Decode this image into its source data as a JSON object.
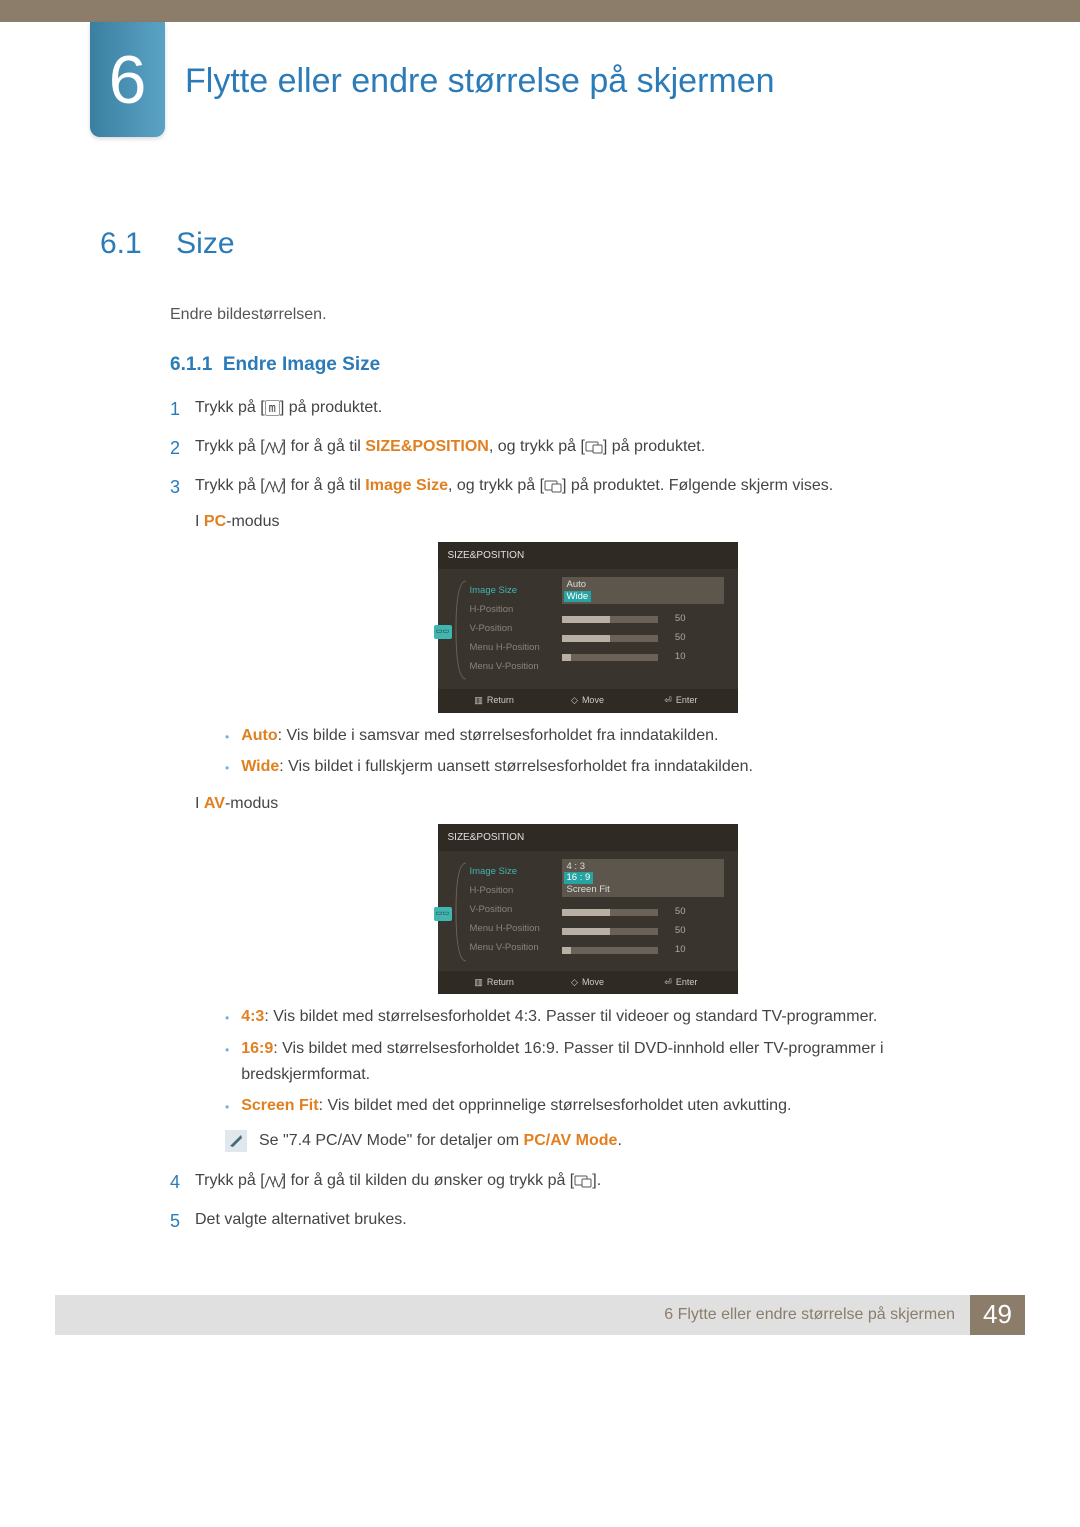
{
  "chapter": {
    "num": "6",
    "title": "Flytte eller endre størrelse på skjermen"
  },
  "section": {
    "num": "6.1",
    "title": "Size",
    "intro": "Endre bildestørrelsen."
  },
  "subsection": {
    "num": "6.1.1",
    "title": "Endre Image Size"
  },
  "steps": {
    "s1": {
      "pre": "Trykk på [",
      "post": "] på produktet.",
      "btn": "m"
    },
    "s2": {
      "a": "Trykk på [",
      "b": "] for å gå til ",
      "hl": "SIZE&POSITION",
      "c": ", og trykk på [",
      "d": "] på produktet."
    },
    "s3": {
      "a": "Trykk på [",
      "b": "] for å gå til ",
      "hl": "Image Size",
      "c": ", og trykk på [",
      "d": "] på produktet. Følgende skjerm vises."
    },
    "pcmode": {
      "pre": "I ",
      "hl": "PC",
      "post": "-modus"
    },
    "avmode": {
      "pre": "I ",
      "hl": "AV",
      "post": "-modus"
    },
    "s4": {
      "a": "Trykk på [",
      "b": "] for å gå til kilden du ønsker og trykk på [",
      "c": "]."
    },
    "s5": "Det valgte alternativet brukes."
  },
  "osd": {
    "title": "SIZE&POSITION",
    "row_imgsize": "Image Size",
    "row_hpos": "H-Position",
    "row_vpos": "V-Position",
    "row_mhpos": "Menu H-Position",
    "row_mvpos": "Menu V-Position",
    "val50": "50",
    "val10": "10",
    "pc": {
      "opt1": "Auto",
      "opt2": "Wide"
    },
    "av": {
      "opt1": "4 : 3",
      "opt2": "16 : 9",
      "opt3": "Screen Fit"
    },
    "foot": {
      "return": "Return",
      "move": "Move",
      "enter": "Enter"
    }
  },
  "bullets_pc": {
    "auto": {
      "hl": "Auto",
      "txt": ": Vis bilde i samsvar med størrelsesforholdet fra inndatakilden."
    },
    "wide": {
      "hl": "Wide",
      "txt": ": Vis bildet i fullskjerm uansett størrelsesforholdet fra inndatakilden."
    }
  },
  "bullets_av": {
    "r43": {
      "hl": "4:3",
      "txt": ": Vis bildet med størrelsesforholdet 4:3. Passer til videoer og standard TV-programmer."
    },
    "r169": {
      "hl": "16:9",
      "txt": ": Vis bildet med størrelsesforholdet 16:9. Passer til DVD-innhold eller TV-programmer i bredskjermformat."
    },
    "sf": {
      "hl": "Screen Fit",
      "txt": ": Vis bildet med det opprinnelige størrelsesforholdet uten avkutting."
    }
  },
  "note": {
    "a": "Se \"7.4 PC/AV Mode\" for detaljer om ",
    "hl": "PC/AV Mode",
    "b": "."
  },
  "footer": {
    "text": "6 Flytte eller endre størrelse på skjermen",
    "page": "49"
  }
}
